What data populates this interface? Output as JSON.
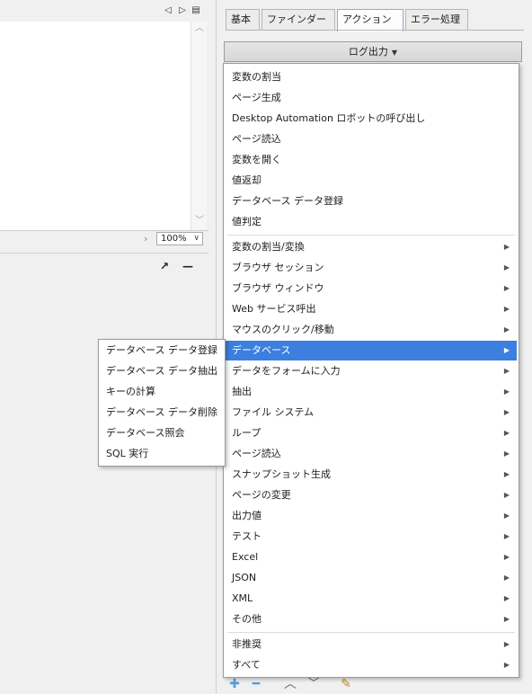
{
  "left_pane": {
    "nav": {
      "prev_icon": "triangle-left-icon",
      "next_icon": "triangle-right-icon",
      "list_icon": "list-icon"
    },
    "zoom": {
      "value": "100%"
    },
    "panel_tools": {
      "expand_icon": "arrow-diagonal-icon",
      "minimize_icon": "minus-icon"
    }
  },
  "tabs": [
    {
      "label": "基本",
      "active": false
    },
    {
      "label": "ファインダー",
      "active": false
    },
    {
      "label": "アクション",
      "active": true
    },
    {
      "label": "エラー処理",
      "active": false
    }
  ],
  "action_button": {
    "label": "ログ出力"
  },
  "menu": {
    "group1": [
      "変数の割当",
      "ページ生成",
      "Desktop Automation ロボットの呼び出し",
      "ページ読込",
      "変数を開く",
      "値返却",
      "データベース データ登録",
      "値判定"
    ],
    "group2": [
      "変数の割当/変換",
      "ブラウザ セッション",
      "ブラウザ ウィンドウ",
      "Web サービス呼出",
      "マウスのクリック/移動",
      "データベース",
      "データをフォームに入力",
      "抽出",
      "ファイル システム",
      "ループ",
      "ページ読込",
      "スナップショット生成",
      "ページの変更",
      "出力値",
      "テスト",
      "Excel",
      "JSON",
      "XML",
      "その他"
    ],
    "group3": [
      "非推奨",
      "すべて"
    ],
    "selected": "データベース"
  },
  "submenu": {
    "items": [
      "データベース データ登録",
      "データベース データ抽出",
      "キーの計算",
      "データベース データ削除",
      "データベース照会",
      "SQL 実行"
    ]
  },
  "bottom_tools": {
    "add_icon": "plus-icon",
    "remove_icon": "minus-icon",
    "up_icon": "chevron-up-icon",
    "down_icon": "chevron-down-icon",
    "edit_icon": "edit-icon"
  },
  "colors": {
    "accent": "#3c7fdf",
    "menu_bg": "#ffffff",
    "window_bg": "#f0f0f0"
  }
}
